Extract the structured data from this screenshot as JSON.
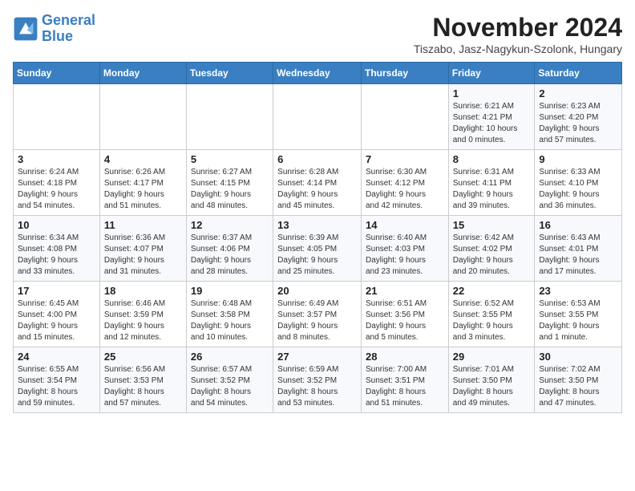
{
  "header": {
    "logo_line1": "General",
    "logo_line2": "Blue",
    "month_title": "November 2024",
    "subtitle": "Tiszabo, Jasz-Nagykun-Szolonk, Hungary"
  },
  "days_of_week": [
    "Sunday",
    "Monday",
    "Tuesday",
    "Wednesday",
    "Thursday",
    "Friday",
    "Saturday"
  ],
  "weeks": [
    [
      {
        "day": "",
        "info": ""
      },
      {
        "day": "",
        "info": ""
      },
      {
        "day": "",
        "info": ""
      },
      {
        "day": "",
        "info": ""
      },
      {
        "day": "",
        "info": ""
      },
      {
        "day": "1",
        "info": "Sunrise: 6:21 AM\nSunset: 4:21 PM\nDaylight: 10 hours\nand 0 minutes."
      },
      {
        "day": "2",
        "info": "Sunrise: 6:23 AM\nSunset: 4:20 PM\nDaylight: 9 hours\nand 57 minutes."
      }
    ],
    [
      {
        "day": "3",
        "info": "Sunrise: 6:24 AM\nSunset: 4:18 PM\nDaylight: 9 hours\nand 54 minutes."
      },
      {
        "day": "4",
        "info": "Sunrise: 6:26 AM\nSunset: 4:17 PM\nDaylight: 9 hours\nand 51 minutes."
      },
      {
        "day": "5",
        "info": "Sunrise: 6:27 AM\nSunset: 4:15 PM\nDaylight: 9 hours\nand 48 minutes."
      },
      {
        "day": "6",
        "info": "Sunrise: 6:28 AM\nSunset: 4:14 PM\nDaylight: 9 hours\nand 45 minutes."
      },
      {
        "day": "7",
        "info": "Sunrise: 6:30 AM\nSunset: 4:12 PM\nDaylight: 9 hours\nand 42 minutes."
      },
      {
        "day": "8",
        "info": "Sunrise: 6:31 AM\nSunset: 4:11 PM\nDaylight: 9 hours\nand 39 minutes."
      },
      {
        "day": "9",
        "info": "Sunrise: 6:33 AM\nSunset: 4:10 PM\nDaylight: 9 hours\nand 36 minutes."
      }
    ],
    [
      {
        "day": "10",
        "info": "Sunrise: 6:34 AM\nSunset: 4:08 PM\nDaylight: 9 hours\nand 33 minutes."
      },
      {
        "day": "11",
        "info": "Sunrise: 6:36 AM\nSunset: 4:07 PM\nDaylight: 9 hours\nand 31 minutes."
      },
      {
        "day": "12",
        "info": "Sunrise: 6:37 AM\nSunset: 4:06 PM\nDaylight: 9 hours\nand 28 minutes."
      },
      {
        "day": "13",
        "info": "Sunrise: 6:39 AM\nSunset: 4:05 PM\nDaylight: 9 hours\nand 25 minutes."
      },
      {
        "day": "14",
        "info": "Sunrise: 6:40 AM\nSunset: 4:03 PM\nDaylight: 9 hours\nand 23 minutes."
      },
      {
        "day": "15",
        "info": "Sunrise: 6:42 AM\nSunset: 4:02 PM\nDaylight: 9 hours\nand 20 minutes."
      },
      {
        "day": "16",
        "info": "Sunrise: 6:43 AM\nSunset: 4:01 PM\nDaylight: 9 hours\nand 17 minutes."
      }
    ],
    [
      {
        "day": "17",
        "info": "Sunrise: 6:45 AM\nSunset: 4:00 PM\nDaylight: 9 hours\nand 15 minutes."
      },
      {
        "day": "18",
        "info": "Sunrise: 6:46 AM\nSunset: 3:59 PM\nDaylight: 9 hours\nand 12 minutes."
      },
      {
        "day": "19",
        "info": "Sunrise: 6:48 AM\nSunset: 3:58 PM\nDaylight: 9 hours\nand 10 minutes."
      },
      {
        "day": "20",
        "info": "Sunrise: 6:49 AM\nSunset: 3:57 PM\nDaylight: 9 hours\nand 8 minutes."
      },
      {
        "day": "21",
        "info": "Sunrise: 6:51 AM\nSunset: 3:56 PM\nDaylight: 9 hours\nand 5 minutes."
      },
      {
        "day": "22",
        "info": "Sunrise: 6:52 AM\nSunset: 3:55 PM\nDaylight: 9 hours\nand 3 minutes."
      },
      {
        "day": "23",
        "info": "Sunrise: 6:53 AM\nSunset: 3:55 PM\nDaylight: 9 hours\nand 1 minute."
      }
    ],
    [
      {
        "day": "24",
        "info": "Sunrise: 6:55 AM\nSunset: 3:54 PM\nDaylight: 8 hours\nand 59 minutes."
      },
      {
        "day": "25",
        "info": "Sunrise: 6:56 AM\nSunset: 3:53 PM\nDaylight: 8 hours\nand 57 minutes."
      },
      {
        "day": "26",
        "info": "Sunrise: 6:57 AM\nSunset: 3:52 PM\nDaylight: 8 hours\nand 54 minutes."
      },
      {
        "day": "27",
        "info": "Sunrise: 6:59 AM\nSunset: 3:52 PM\nDaylight: 8 hours\nand 53 minutes."
      },
      {
        "day": "28",
        "info": "Sunrise: 7:00 AM\nSunset: 3:51 PM\nDaylight: 8 hours\nand 51 minutes."
      },
      {
        "day": "29",
        "info": "Sunrise: 7:01 AM\nSunset: 3:50 PM\nDaylight: 8 hours\nand 49 minutes."
      },
      {
        "day": "30",
        "info": "Sunrise: 7:02 AM\nSunset: 3:50 PM\nDaylight: 8 hours\nand 47 minutes."
      }
    ]
  ]
}
